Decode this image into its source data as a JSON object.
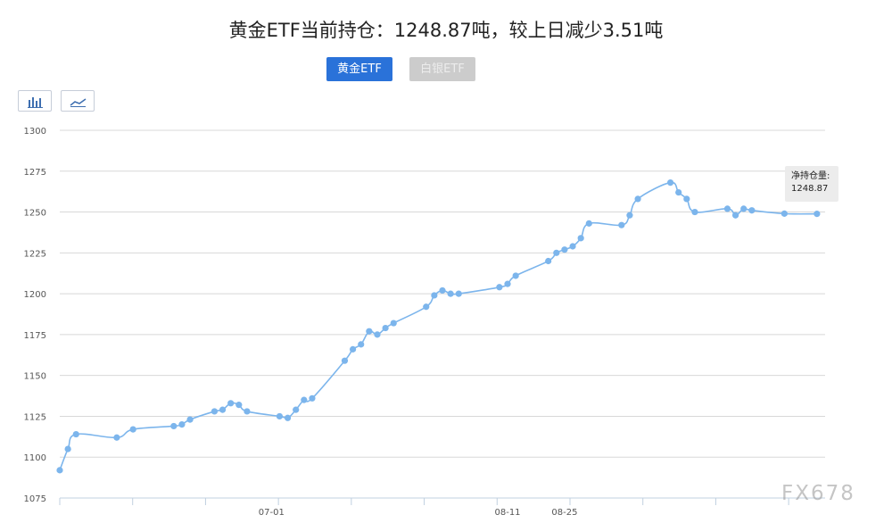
{
  "header": {
    "title": "黄金ETF当前持仓：1248.87吨，较上日减少3.51吨"
  },
  "tabs": [
    {
      "label": "黄金ETF",
      "active": true
    },
    {
      "label": "白银ETF",
      "active": false
    }
  ],
  "chart_modes": {
    "bar_icon": "bar-chart-icon",
    "line_icon": "line-chart-icon",
    "active": "line"
  },
  "colors": {
    "line": "#7cb5ec",
    "tab_active": "#2a72d9",
    "tab_inactive": "#cccccc"
  },
  "tooltip": {
    "label": "净持仓量:",
    "value": "1248.87"
  },
  "watermark": "FX678",
  "chart_data": {
    "type": "line",
    "ylim": [
      1075,
      1300
    ],
    "yticks": [
      1075,
      1100,
      1125,
      1150,
      1175,
      1200,
      1225,
      1250,
      1275,
      1300
    ],
    "xtick_labels": [
      {
        "label": "07-01",
        "index": 26
      },
      {
        "label": "08-11",
        "index": 55
      },
      {
        "label": "08-25",
        "index": 62
      }
    ],
    "x": [
      0,
      1,
      2,
      7,
      9,
      14,
      15,
      16,
      19,
      20,
      21,
      22,
      23,
      27,
      28,
      29,
      30,
      31,
      35,
      36,
      37,
      38,
      39,
      40,
      41,
      45,
      46,
      47,
      48,
      49,
      54,
      55,
      56,
      60,
      61,
      62,
      63,
      64,
      65,
      69,
      70,
      71,
      75,
      76,
      77,
      78,
      82,
      83,
      84,
      85,
      89,
      93
    ],
    "values": [
      1092,
      1105,
      1114,
      1112,
      1117,
      1119,
      1120,
      1123,
      1128,
      1129,
      1133,
      1132,
      1128,
      1125,
      1124,
      1129,
      1135,
      1136,
      1159,
      1166,
      1169,
      1177,
      1175,
      1179,
      1182,
      1192,
      1199,
      1202,
      1200,
      1200,
      1204,
      1206,
      1211,
      1220,
      1225,
      1227,
      1229,
      1234,
      1243,
      1242,
      1248,
      1258,
      1268,
      1262,
      1258,
      1250,
      1252,
      1248,
      1252,
      1251,
      1249,
      1248.87
    ]
  }
}
